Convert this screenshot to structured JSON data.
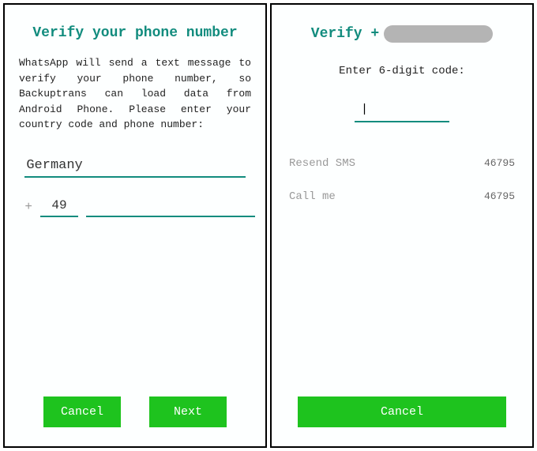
{
  "left": {
    "title": "Verify your phone number",
    "description": "WhatsApp will send a text message to verify your phone number, so Backuptrans can load data from Android Phone. Please enter your country code and phone number:",
    "country": "Germany",
    "plus": "+",
    "code": "49",
    "phone": "",
    "cancel": "Cancel",
    "next": "Next"
  },
  "right": {
    "title_prefix": "Verify +",
    "enter_label": "Enter 6-digit code:",
    "code_value": "|",
    "resend_label": "Resend SMS",
    "resend_timer": "46795",
    "call_label": "Call me",
    "call_timer": "46795",
    "cancel": "Cancel"
  }
}
